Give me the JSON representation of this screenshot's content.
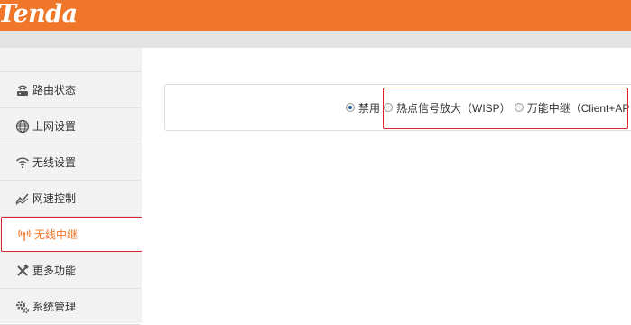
{
  "brand": {
    "logo_text": "Tenda",
    "primary_color": "#f0772a",
    "highlight_color": "#d9262c"
  },
  "sidebar": {
    "items": [
      {
        "label": "路由状态",
        "icon": "router-icon"
      },
      {
        "label": "上网设置",
        "icon": "globe-icon"
      },
      {
        "label": "无线设置",
        "icon": "wifi-icon"
      },
      {
        "label": "网速控制",
        "icon": "speed-chart-icon"
      },
      {
        "label": "无线中继",
        "icon": "antenna-icon",
        "active": true
      },
      {
        "label": "更多功能",
        "icon": "tools-icon"
      },
      {
        "label": "系统管理",
        "icon": "gear-icon"
      }
    ]
  },
  "relay_mode": {
    "options": [
      {
        "label": "禁用",
        "checked": true
      },
      {
        "label": "热点信号放大（WISP）",
        "checked": false
      },
      {
        "label": "万能中继（Client+AP",
        "checked": false
      }
    ]
  }
}
